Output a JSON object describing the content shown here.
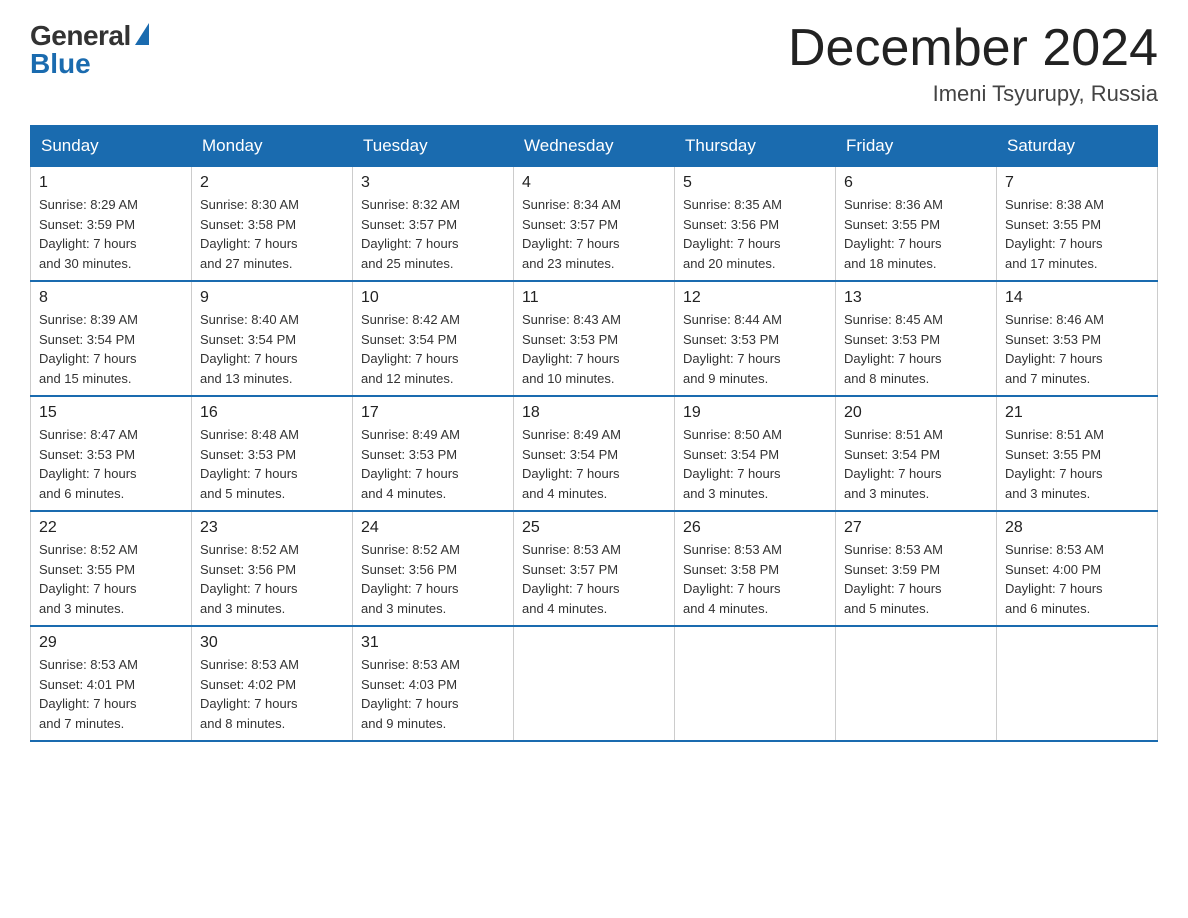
{
  "header": {
    "logo_general": "General",
    "logo_blue": "Blue",
    "title": "December 2024",
    "location": "Imeni Tsyurupy, Russia"
  },
  "weekdays": [
    "Sunday",
    "Monday",
    "Tuesday",
    "Wednesday",
    "Thursday",
    "Friday",
    "Saturday"
  ],
  "weeks": [
    [
      {
        "day": "1",
        "sunrise": "8:29 AM",
        "sunset": "3:59 PM",
        "daylight": "7 hours and 30 minutes."
      },
      {
        "day": "2",
        "sunrise": "8:30 AM",
        "sunset": "3:58 PM",
        "daylight": "7 hours and 27 minutes."
      },
      {
        "day": "3",
        "sunrise": "8:32 AM",
        "sunset": "3:57 PM",
        "daylight": "7 hours and 25 minutes."
      },
      {
        "day": "4",
        "sunrise": "8:34 AM",
        "sunset": "3:57 PM",
        "daylight": "7 hours and 23 minutes."
      },
      {
        "day": "5",
        "sunrise": "8:35 AM",
        "sunset": "3:56 PM",
        "daylight": "7 hours and 20 minutes."
      },
      {
        "day": "6",
        "sunrise": "8:36 AM",
        "sunset": "3:55 PM",
        "daylight": "7 hours and 18 minutes."
      },
      {
        "day": "7",
        "sunrise": "8:38 AM",
        "sunset": "3:55 PM",
        "daylight": "7 hours and 17 minutes."
      }
    ],
    [
      {
        "day": "8",
        "sunrise": "8:39 AM",
        "sunset": "3:54 PM",
        "daylight": "7 hours and 15 minutes."
      },
      {
        "day": "9",
        "sunrise": "8:40 AM",
        "sunset": "3:54 PM",
        "daylight": "7 hours and 13 minutes."
      },
      {
        "day": "10",
        "sunrise": "8:42 AM",
        "sunset": "3:54 PM",
        "daylight": "7 hours and 12 minutes."
      },
      {
        "day": "11",
        "sunrise": "8:43 AM",
        "sunset": "3:53 PM",
        "daylight": "7 hours and 10 minutes."
      },
      {
        "day": "12",
        "sunrise": "8:44 AM",
        "sunset": "3:53 PM",
        "daylight": "7 hours and 9 minutes."
      },
      {
        "day": "13",
        "sunrise": "8:45 AM",
        "sunset": "3:53 PM",
        "daylight": "7 hours and 8 minutes."
      },
      {
        "day": "14",
        "sunrise": "8:46 AM",
        "sunset": "3:53 PM",
        "daylight": "7 hours and 7 minutes."
      }
    ],
    [
      {
        "day": "15",
        "sunrise": "8:47 AM",
        "sunset": "3:53 PM",
        "daylight": "7 hours and 6 minutes."
      },
      {
        "day": "16",
        "sunrise": "8:48 AM",
        "sunset": "3:53 PM",
        "daylight": "7 hours and 5 minutes."
      },
      {
        "day": "17",
        "sunrise": "8:49 AM",
        "sunset": "3:53 PM",
        "daylight": "7 hours and 4 minutes."
      },
      {
        "day": "18",
        "sunrise": "8:49 AM",
        "sunset": "3:54 PM",
        "daylight": "7 hours and 4 minutes."
      },
      {
        "day": "19",
        "sunrise": "8:50 AM",
        "sunset": "3:54 PM",
        "daylight": "7 hours and 3 minutes."
      },
      {
        "day": "20",
        "sunrise": "8:51 AM",
        "sunset": "3:54 PM",
        "daylight": "7 hours and 3 minutes."
      },
      {
        "day": "21",
        "sunrise": "8:51 AM",
        "sunset": "3:55 PM",
        "daylight": "7 hours and 3 minutes."
      }
    ],
    [
      {
        "day": "22",
        "sunrise": "8:52 AM",
        "sunset": "3:55 PM",
        "daylight": "7 hours and 3 minutes."
      },
      {
        "day": "23",
        "sunrise": "8:52 AM",
        "sunset": "3:56 PM",
        "daylight": "7 hours and 3 minutes."
      },
      {
        "day": "24",
        "sunrise": "8:52 AM",
        "sunset": "3:56 PM",
        "daylight": "7 hours and 3 minutes."
      },
      {
        "day": "25",
        "sunrise": "8:53 AM",
        "sunset": "3:57 PM",
        "daylight": "7 hours and 4 minutes."
      },
      {
        "day": "26",
        "sunrise": "8:53 AM",
        "sunset": "3:58 PM",
        "daylight": "7 hours and 4 minutes."
      },
      {
        "day": "27",
        "sunrise": "8:53 AM",
        "sunset": "3:59 PM",
        "daylight": "7 hours and 5 minutes."
      },
      {
        "day": "28",
        "sunrise": "8:53 AM",
        "sunset": "4:00 PM",
        "daylight": "7 hours and 6 minutes."
      }
    ],
    [
      {
        "day": "29",
        "sunrise": "8:53 AM",
        "sunset": "4:01 PM",
        "daylight": "7 hours and 7 minutes."
      },
      {
        "day": "30",
        "sunrise": "8:53 AM",
        "sunset": "4:02 PM",
        "daylight": "7 hours and 8 minutes."
      },
      {
        "day": "31",
        "sunrise": "8:53 AM",
        "sunset": "4:03 PM",
        "daylight": "7 hours and 9 minutes."
      },
      null,
      null,
      null,
      null
    ]
  ],
  "labels": {
    "sunrise": "Sunrise:",
    "sunset": "Sunset:",
    "daylight": "Daylight:"
  }
}
